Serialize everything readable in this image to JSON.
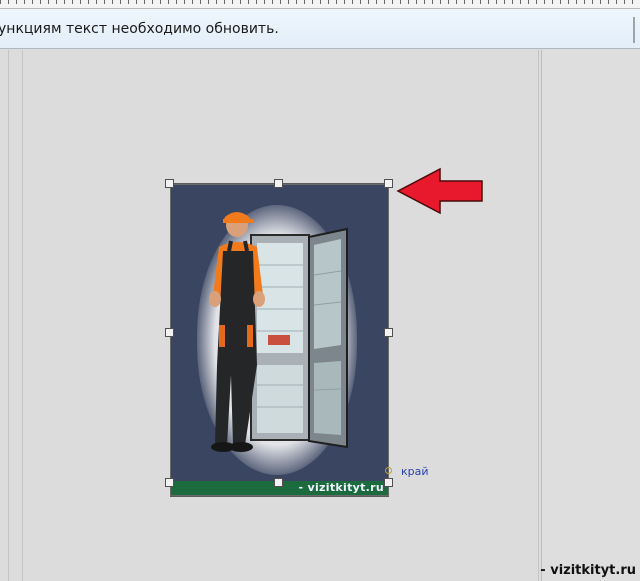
{
  "notice": {
    "text": "ункциям текст необходимо обновить."
  },
  "canvas": {
    "card_site_text": "- vizitkityt.ru",
    "edge_label": "край"
  },
  "watermark": "- vizitkityt.ru",
  "colors": {
    "card_background": "#3a4561",
    "card_strip": "#1c6b3e",
    "arrow": "#e8192c",
    "edge_label": "#2b3fb6",
    "notice_background": "#e9f2fb"
  },
  "icons": {
    "pointer": "red-arrow-icon"
  }
}
